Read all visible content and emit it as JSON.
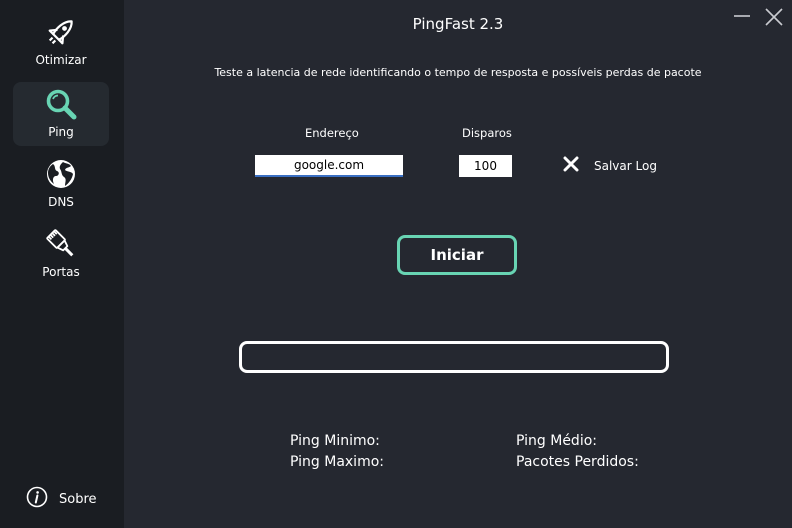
{
  "app": {
    "title": "PingFast 2.3"
  },
  "sidebar": {
    "items": [
      {
        "label": "Otimizar",
        "icon": "rocket-icon"
      },
      {
        "label": "Ping",
        "icon": "magnifier-icon",
        "active": true
      },
      {
        "label": "DNS",
        "icon": "globe-icon"
      },
      {
        "label": "Portas",
        "icon": "ethernet-cable-icon"
      }
    ],
    "about": {
      "label": "Sobre",
      "icon": "info-icon"
    }
  },
  "main": {
    "subtitle": "Teste a latencia de rede  identificando o tempo de resposta e possíveis perdas de pacote",
    "address": {
      "label": "Endereço",
      "value": "google.com"
    },
    "shots": {
      "label": "Disparos",
      "value": "100"
    },
    "save_log": {
      "label": "Salvar Log",
      "checked": false,
      "icon": "x-icon"
    },
    "start_button": "Iniciar",
    "progress": 0,
    "stats": {
      "min": "Ping Minimo:",
      "avg": "Ping Médio:",
      "max": "Ping Maximo:",
      "lost": "Pacotes Perdidos:"
    }
  },
  "colors": {
    "accent": "#68d4b3",
    "sidebar_bg": "#1a1d22",
    "main_bg": "#252830",
    "input_underline": "#3a6fc2"
  }
}
